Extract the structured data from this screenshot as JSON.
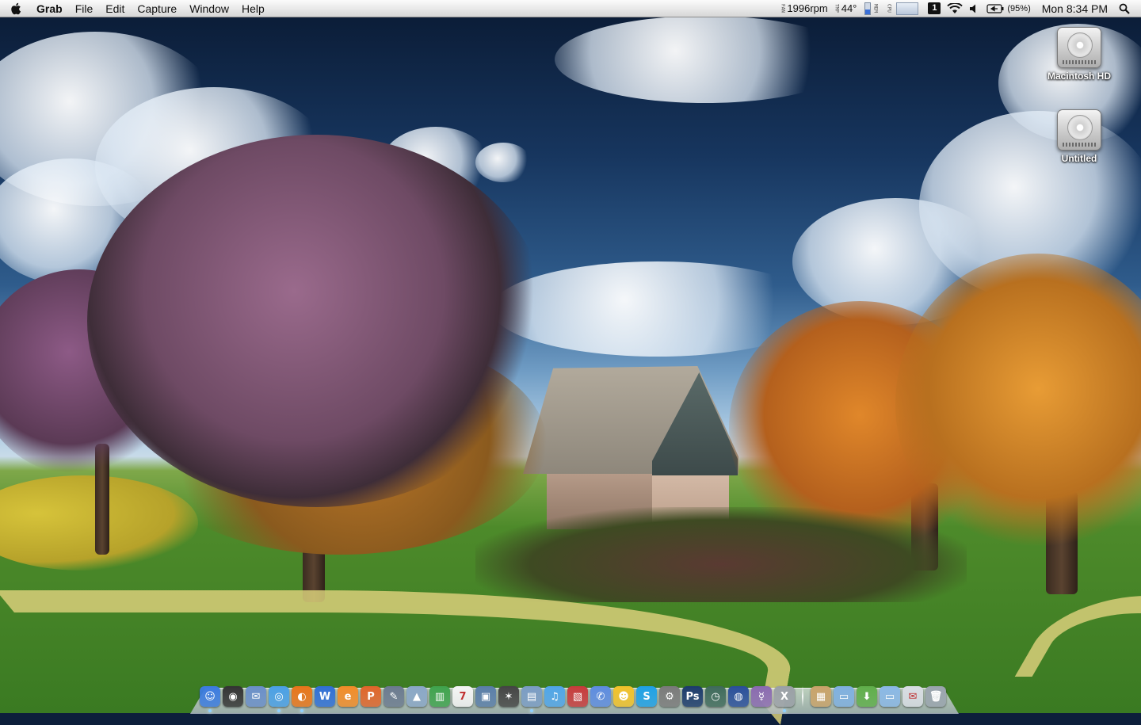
{
  "menubar": {
    "app_name": "Grab",
    "menus": [
      "File",
      "Edit",
      "Capture",
      "Window",
      "Help"
    ],
    "fan_label": "FAN",
    "fan_speed": "1996rpm",
    "temp_label": "TMP",
    "temperature": "44°",
    "mem_label": "MEM",
    "cpu_label": "CPU",
    "battery": "(95%)",
    "clock": "Mon 8:34 PM"
  },
  "desktop": {
    "icons": [
      {
        "label": "Macintosh HD"
      },
      {
        "label": "Untitled"
      }
    ]
  },
  "dock": {
    "apps": [
      {
        "icon": "finder-icon",
        "color": "#3b7be0",
        "glyph": "☺",
        "running": true
      },
      {
        "icon": "dashboard-icon",
        "color": "#333333",
        "glyph": "◉",
        "running": false
      },
      {
        "icon": "mail-icon",
        "color": "#6a8fc9",
        "glyph": "✉",
        "running": false
      },
      {
        "icon": "safari-icon",
        "color": "#4aa0e6",
        "glyph": "◎",
        "running": true
      },
      {
        "icon": "firefox-icon",
        "color": "#e8751a",
        "glyph": "◐",
        "running": true
      },
      {
        "icon": "word-icon",
        "color": "#2f6fd6",
        "glyph": "W",
        "running": false
      },
      {
        "icon": "entourage-icon",
        "color": "#f28c28",
        "glyph": "e",
        "running": false
      },
      {
        "icon": "powerpoint-icon",
        "color": "#e0652a",
        "glyph": "P",
        "running": false
      },
      {
        "icon": "script-editor-icon",
        "color": "#6b7a8f",
        "glyph": "✎",
        "running": false
      },
      {
        "icon": "keynote-icon",
        "color": "#8aa7c7",
        "glyph": "▲",
        "running": false
      },
      {
        "icon": "numbers-icon",
        "color": "#3fa34d",
        "glyph": "▥",
        "running": false
      },
      {
        "icon": "ical-icon",
        "color": "#f4f4f4",
        "glyph": "7",
        "running": false
      },
      {
        "icon": "iphoto-icon",
        "color": "#5a7ea8",
        "glyph": "▣",
        "running": false
      },
      {
        "icon": "aperture-icon",
        "color": "#444444",
        "glyph": "✶",
        "running": false
      },
      {
        "icon": "preview-icon",
        "color": "#7a9cc4",
        "glyph": "▤",
        "running": true
      },
      {
        "icon": "itunes-icon",
        "color": "#4fa5e8",
        "glyph": "♫",
        "running": false
      },
      {
        "icon": "parallels-icon",
        "color": "#c73b3b",
        "glyph": "▧",
        "running": false
      },
      {
        "icon": "ichat-icon",
        "color": "#5d8ce0",
        "glyph": "✆",
        "running": false
      },
      {
        "icon": "adium-icon",
        "color": "#f2c22a",
        "glyph": "☻",
        "running": false
      },
      {
        "icon": "skype-icon",
        "color": "#1ea1e6",
        "glyph": "S",
        "running": false
      },
      {
        "icon": "system-preferences-icon",
        "color": "#7a7a7a",
        "glyph": "⚙",
        "running": false
      },
      {
        "icon": "photoshop-icon",
        "color": "#1c3b6b",
        "glyph": "Ps",
        "running": false
      },
      {
        "icon": "time-machine-icon",
        "color": "#3f6a5b",
        "glyph": "◷",
        "running": false
      },
      {
        "icon": "network-globe-icon",
        "color": "#2a4f9a",
        "glyph": "◍",
        "running": false
      },
      {
        "icon": "gender-app-icon",
        "color": "#8a6ab0",
        "glyph": "☿",
        "running": false
      },
      {
        "icon": "x11-icon",
        "color": "#9aa0a6",
        "glyph": "X",
        "running": true
      }
    ],
    "stacks": [
      {
        "icon": "documents-stack-icon",
        "color": "#c9a36a",
        "glyph": "▦"
      },
      {
        "icon": "folder-stack-icon",
        "color": "#7fb0e0",
        "glyph": "▭"
      },
      {
        "icon": "downloads-stack-icon",
        "color": "#5fae4a",
        "glyph": "⬇"
      },
      {
        "icon": "folder-icon",
        "color": "#8ab8e6",
        "glyph": "▭"
      },
      {
        "icon": "mail-drop-icon",
        "color": "#d8dde3",
        "glyph": "✉"
      },
      {
        "icon": "trash-icon",
        "color": "#9aa4ae",
        "glyph": "🗑"
      }
    ]
  }
}
